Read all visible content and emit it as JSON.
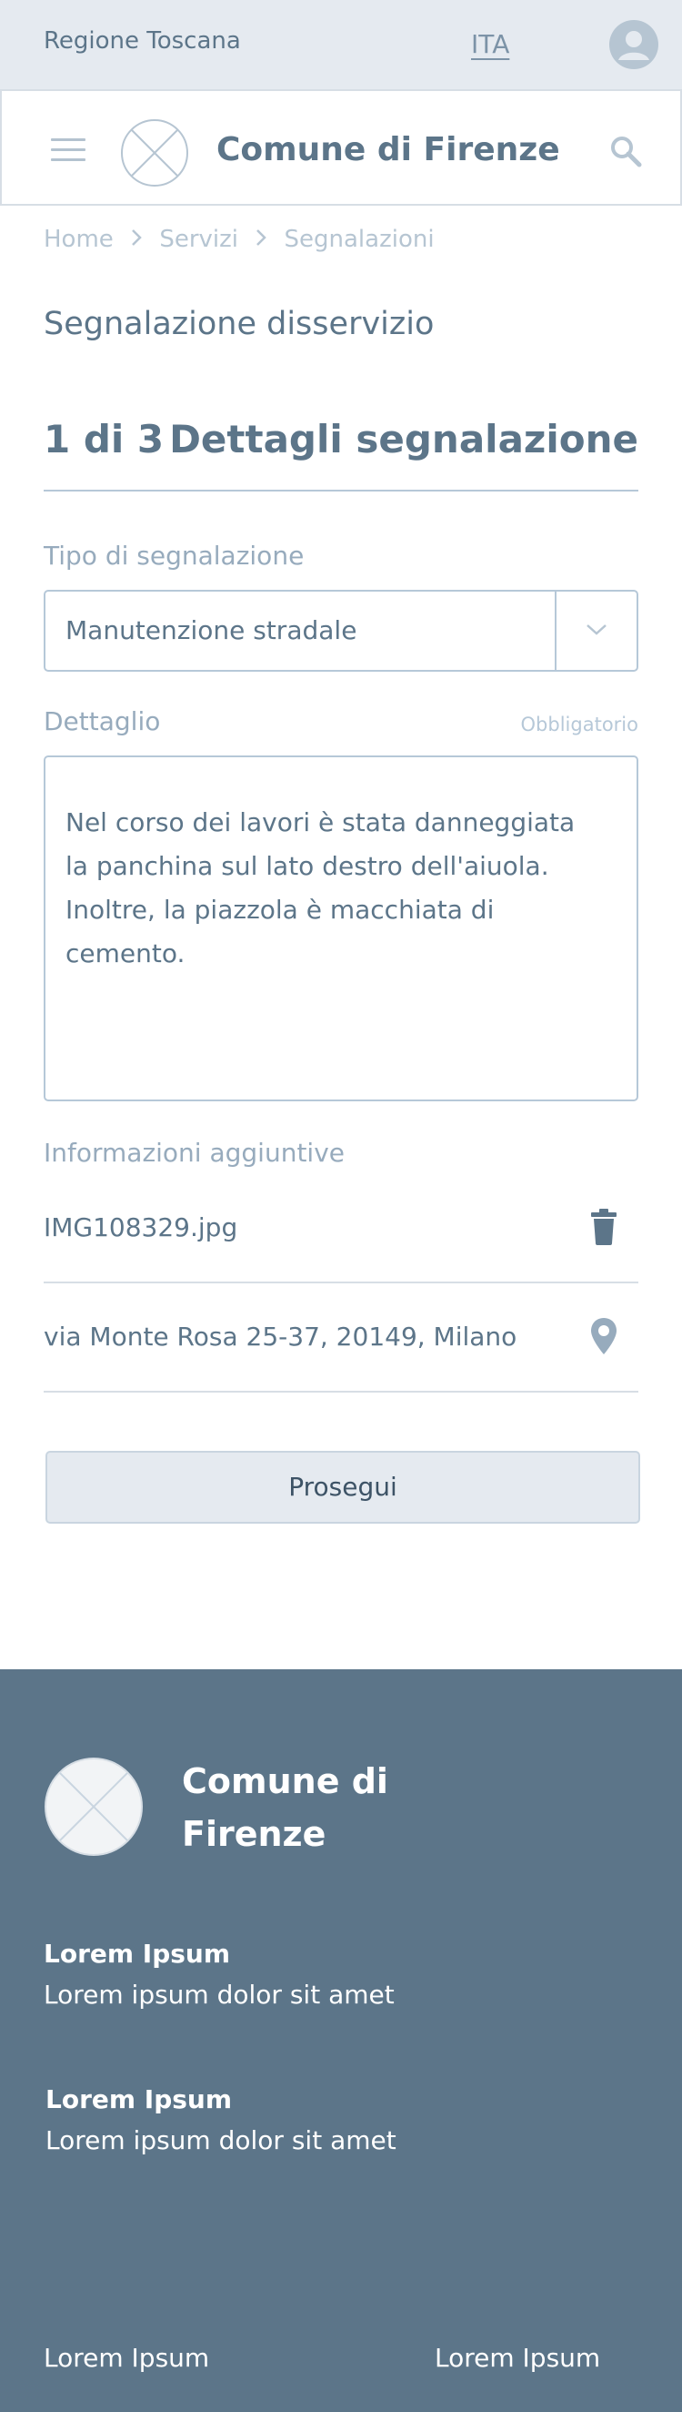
{
  "header": {
    "region": "Regione Toscana",
    "language": "ITA",
    "site_title": "Comune di Firenze"
  },
  "breadcrumb": [
    "Home",
    "Servizi",
    "Segnalazioni"
  ],
  "page_title": "Segnalazione disservizio",
  "step": {
    "counter": "1 di 3",
    "title": "Dettagli segnalazione"
  },
  "form": {
    "type_label": "Tipo di segnalazione",
    "type_value": "Manutenzione stradale",
    "detail_label": "Dettaglio",
    "detail_required": "Obbligatorio",
    "detail_text": "Nel corso dei lavori è stata danneggiata\nla panchina sul lato destro dell'aiuola.\nInoltre, la piazzola è macchiata di\ncemento.",
    "extra_label": "Informazioni aggiuntive",
    "attachment": "IMG108329.jpg",
    "address": "via Monte Rosa 25-37, 20149, Milano",
    "submit_label": "Prosegui"
  },
  "icons": {
    "avatar": "user-avatar-icon",
    "menu": "hamburger-icon",
    "logo": "logo-placeholder-icon",
    "search": "search-icon",
    "chevron": "chevron-down-icon",
    "delete": "trash-icon",
    "location": "map-pin-icon"
  },
  "footer": {
    "title": "Comune di Firenze",
    "blocks": [
      {
        "heading": "Lorem Ipsum",
        "text": "Lorem ipsum dolor sit amet"
      },
      {
        "heading": "Lorem Ipsum",
        "text": "Lorem ipsum dolor sit amet"
      }
    ],
    "links": [
      "Lorem Ipsum",
      "Lorem Ipsum"
    ]
  },
  "colors": {
    "primary": "#5c7589",
    "light_bg": "#e5eaf0",
    "border": "#b6c8d8",
    "muted_text": "#97abbd"
  }
}
